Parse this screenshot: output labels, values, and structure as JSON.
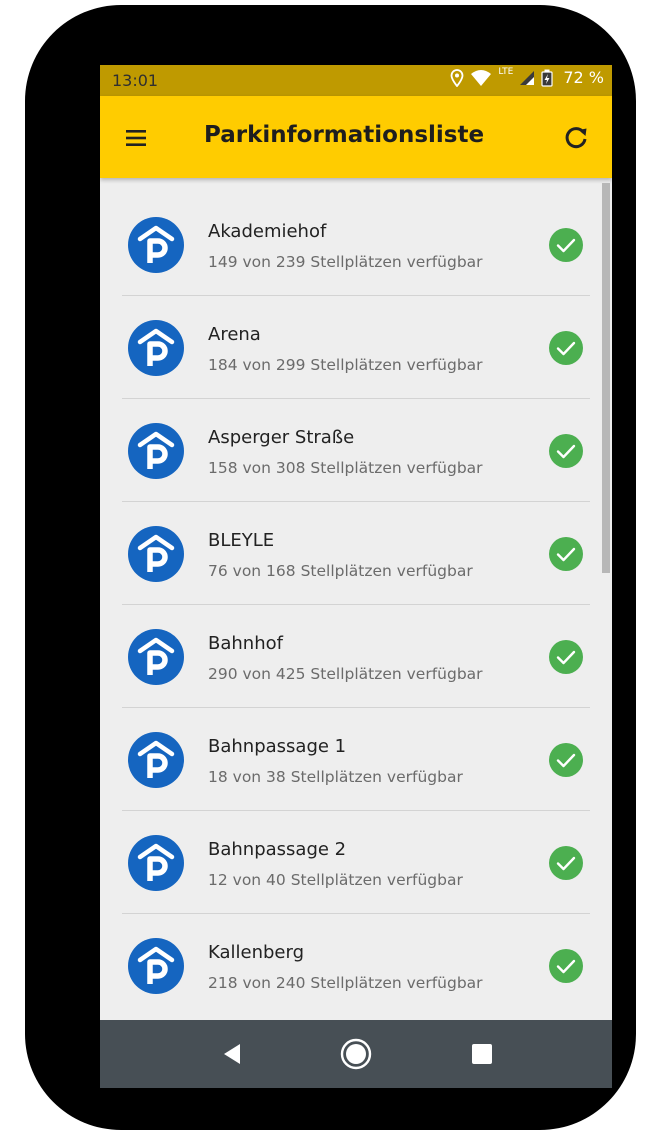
{
  "status": {
    "time": "13:01",
    "network": "LTE",
    "battery": "72 %"
  },
  "appbar": {
    "title": "Parkinformationsliste",
    "menu_icon": "menu-icon",
    "refresh_icon": "refresh-icon"
  },
  "colors": {
    "appbar": "#ffcc00",
    "status": "#bf9a00",
    "parking_blue": "#1565c0",
    "available_green": "#4caf50",
    "navbar": "#474f55"
  },
  "list": [
    {
      "name": "Akademiehof",
      "availability": "149 von 239 Stellplätzen verfügbar",
      "status_icon": "check-icon"
    },
    {
      "name": "Arena",
      "availability": "184 von 299 Stellplätzen verfügbar",
      "status_icon": "check-icon"
    },
    {
      "name": "Asperger Straße",
      "availability": "158 von 308 Stellplätzen verfügbar",
      "status_icon": "check-icon"
    },
    {
      "name": "BLEYLE",
      "availability": "76 von 168 Stellplätzen verfügbar",
      "status_icon": "check-icon"
    },
    {
      "name": "Bahnhof",
      "availability": "290 von 425 Stellplätzen verfügbar",
      "status_icon": "check-icon"
    },
    {
      "name": "Bahnpassage 1",
      "availability": "18 von 38 Stellplätzen verfügbar",
      "status_icon": "check-icon"
    },
    {
      "name": "Bahnpassage 2",
      "availability": "12 von 40 Stellplätzen verfügbar",
      "status_icon": "check-icon"
    },
    {
      "name": "Kallenberg",
      "availability": "218 von 240 Stellplätzen verfügbar",
      "status_icon": "check-icon"
    }
  ],
  "navbar": {
    "back_icon": "back-icon",
    "home_icon": "home-icon",
    "recents_icon": "recents-icon"
  }
}
